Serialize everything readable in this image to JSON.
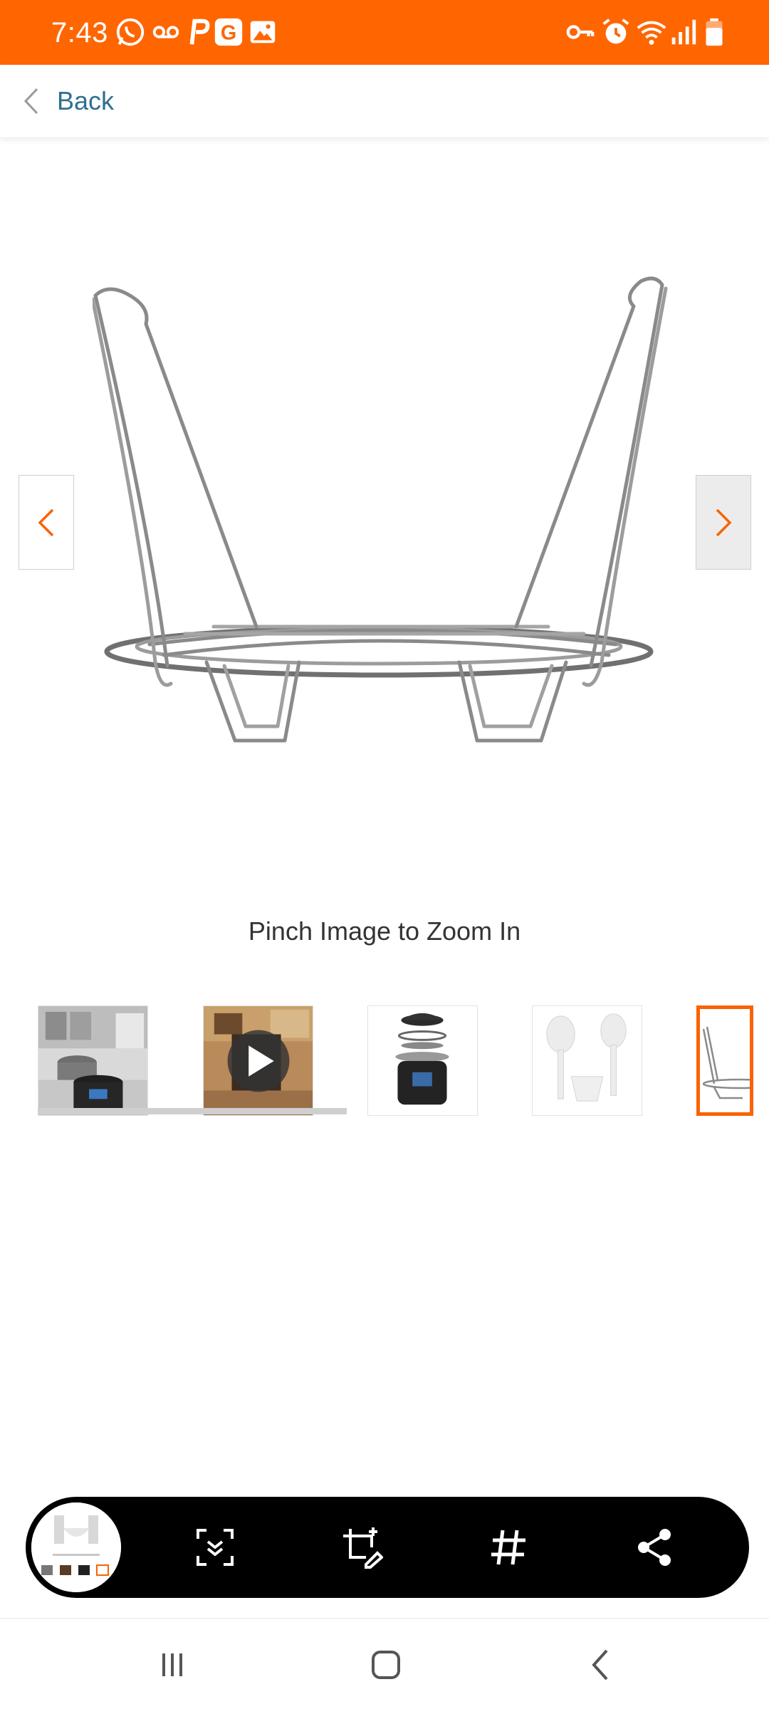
{
  "status_bar": {
    "time": "7:43",
    "background_color": "#ff6600",
    "left_icons": [
      "whatsapp-icon",
      "voicemail-icon",
      "p-app-icon",
      "g-app-icon",
      "gallery-icon"
    ],
    "right_icons": [
      "vpn-key-icon",
      "alarm-icon",
      "wifi-icon",
      "signal-icon",
      "battery-icon"
    ]
  },
  "header": {
    "back_label": "Back",
    "back_color": "#2f6f8f"
  },
  "gallery": {
    "zoom_hint": "Pinch Image to Zoom In",
    "prev_icon": "chevron-left-icon",
    "next_icon": "chevron-right-icon",
    "accent_color": "#f96302",
    "thumbnails": [
      {
        "name": "kitchen-scene-thumbnail",
        "type": "image"
      },
      {
        "name": "video-thumbnail",
        "type": "video",
        "icon": "play-icon"
      },
      {
        "name": "pressure-cooker-exploded-thumbnail",
        "type": "image"
      },
      {
        "name": "utensils-thumbnail",
        "type": "image"
      },
      {
        "name": "steam-rack-thumbnail",
        "type": "image",
        "selected": true
      }
    ]
  },
  "toolbar": {
    "buttons": [
      "smart-select-icon",
      "crop-edit-icon",
      "hashtag-icon",
      "share-icon"
    ]
  },
  "system_nav": {
    "buttons": [
      "recent-apps-icon",
      "home-icon",
      "back-icon"
    ]
  }
}
